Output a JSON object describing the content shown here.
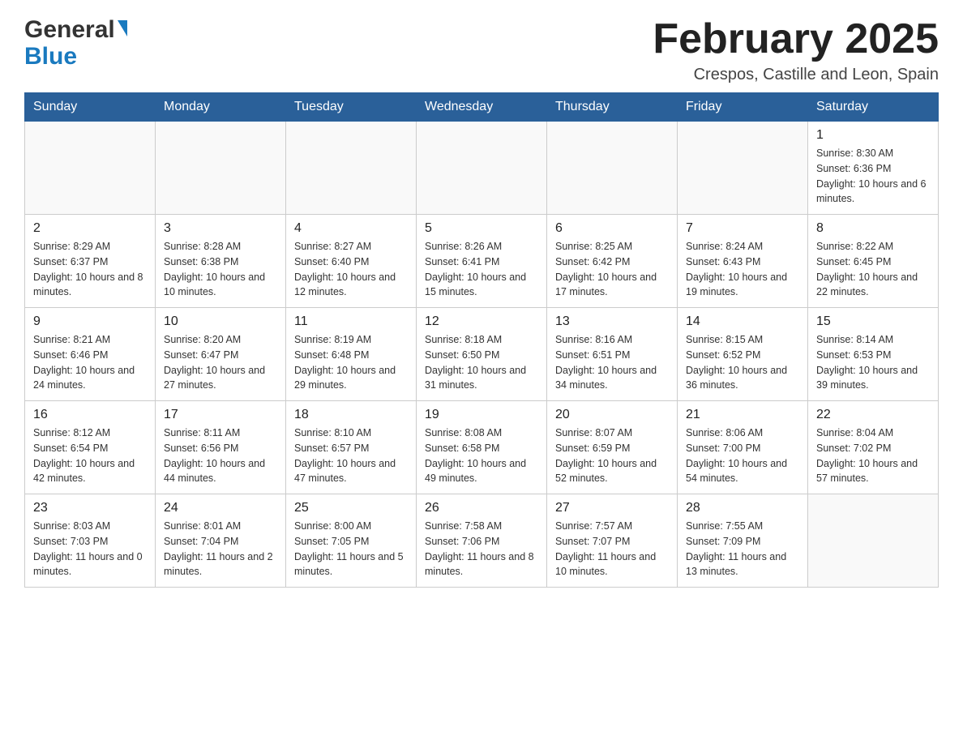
{
  "header": {
    "logo_general": "General",
    "logo_blue": "Blue",
    "month_title": "February 2025",
    "location": "Crespos, Castille and Leon, Spain"
  },
  "days_of_week": [
    "Sunday",
    "Monday",
    "Tuesday",
    "Wednesday",
    "Thursday",
    "Friday",
    "Saturday"
  ],
  "weeks": [
    [
      {
        "day": "",
        "sunrise": "",
        "sunset": "",
        "daylight": ""
      },
      {
        "day": "",
        "sunrise": "",
        "sunset": "",
        "daylight": ""
      },
      {
        "day": "",
        "sunrise": "",
        "sunset": "",
        "daylight": ""
      },
      {
        "day": "",
        "sunrise": "",
        "sunset": "",
        "daylight": ""
      },
      {
        "day": "",
        "sunrise": "",
        "sunset": "",
        "daylight": ""
      },
      {
        "day": "",
        "sunrise": "",
        "sunset": "",
        "daylight": ""
      },
      {
        "day": "1",
        "sunrise": "Sunrise: 8:30 AM",
        "sunset": "Sunset: 6:36 PM",
        "daylight": "Daylight: 10 hours and 6 minutes."
      }
    ],
    [
      {
        "day": "2",
        "sunrise": "Sunrise: 8:29 AM",
        "sunset": "Sunset: 6:37 PM",
        "daylight": "Daylight: 10 hours and 8 minutes."
      },
      {
        "day": "3",
        "sunrise": "Sunrise: 8:28 AM",
        "sunset": "Sunset: 6:38 PM",
        "daylight": "Daylight: 10 hours and 10 minutes."
      },
      {
        "day": "4",
        "sunrise": "Sunrise: 8:27 AM",
        "sunset": "Sunset: 6:40 PM",
        "daylight": "Daylight: 10 hours and 12 minutes."
      },
      {
        "day": "5",
        "sunrise": "Sunrise: 8:26 AM",
        "sunset": "Sunset: 6:41 PM",
        "daylight": "Daylight: 10 hours and 15 minutes."
      },
      {
        "day": "6",
        "sunrise": "Sunrise: 8:25 AM",
        "sunset": "Sunset: 6:42 PM",
        "daylight": "Daylight: 10 hours and 17 minutes."
      },
      {
        "day": "7",
        "sunrise": "Sunrise: 8:24 AM",
        "sunset": "Sunset: 6:43 PM",
        "daylight": "Daylight: 10 hours and 19 minutes."
      },
      {
        "day": "8",
        "sunrise": "Sunrise: 8:22 AM",
        "sunset": "Sunset: 6:45 PM",
        "daylight": "Daylight: 10 hours and 22 minutes."
      }
    ],
    [
      {
        "day": "9",
        "sunrise": "Sunrise: 8:21 AM",
        "sunset": "Sunset: 6:46 PM",
        "daylight": "Daylight: 10 hours and 24 minutes."
      },
      {
        "day": "10",
        "sunrise": "Sunrise: 8:20 AM",
        "sunset": "Sunset: 6:47 PM",
        "daylight": "Daylight: 10 hours and 27 minutes."
      },
      {
        "day": "11",
        "sunrise": "Sunrise: 8:19 AM",
        "sunset": "Sunset: 6:48 PM",
        "daylight": "Daylight: 10 hours and 29 minutes."
      },
      {
        "day": "12",
        "sunrise": "Sunrise: 8:18 AM",
        "sunset": "Sunset: 6:50 PM",
        "daylight": "Daylight: 10 hours and 31 minutes."
      },
      {
        "day": "13",
        "sunrise": "Sunrise: 8:16 AM",
        "sunset": "Sunset: 6:51 PM",
        "daylight": "Daylight: 10 hours and 34 minutes."
      },
      {
        "day": "14",
        "sunrise": "Sunrise: 8:15 AM",
        "sunset": "Sunset: 6:52 PM",
        "daylight": "Daylight: 10 hours and 36 minutes."
      },
      {
        "day": "15",
        "sunrise": "Sunrise: 8:14 AM",
        "sunset": "Sunset: 6:53 PM",
        "daylight": "Daylight: 10 hours and 39 minutes."
      }
    ],
    [
      {
        "day": "16",
        "sunrise": "Sunrise: 8:12 AM",
        "sunset": "Sunset: 6:54 PM",
        "daylight": "Daylight: 10 hours and 42 minutes."
      },
      {
        "day": "17",
        "sunrise": "Sunrise: 8:11 AM",
        "sunset": "Sunset: 6:56 PM",
        "daylight": "Daylight: 10 hours and 44 minutes."
      },
      {
        "day": "18",
        "sunrise": "Sunrise: 8:10 AM",
        "sunset": "Sunset: 6:57 PM",
        "daylight": "Daylight: 10 hours and 47 minutes."
      },
      {
        "day": "19",
        "sunrise": "Sunrise: 8:08 AM",
        "sunset": "Sunset: 6:58 PM",
        "daylight": "Daylight: 10 hours and 49 minutes."
      },
      {
        "day": "20",
        "sunrise": "Sunrise: 8:07 AM",
        "sunset": "Sunset: 6:59 PM",
        "daylight": "Daylight: 10 hours and 52 minutes."
      },
      {
        "day": "21",
        "sunrise": "Sunrise: 8:06 AM",
        "sunset": "Sunset: 7:00 PM",
        "daylight": "Daylight: 10 hours and 54 minutes."
      },
      {
        "day": "22",
        "sunrise": "Sunrise: 8:04 AM",
        "sunset": "Sunset: 7:02 PM",
        "daylight": "Daylight: 10 hours and 57 minutes."
      }
    ],
    [
      {
        "day": "23",
        "sunrise": "Sunrise: 8:03 AM",
        "sunset": "Sunset: 7:03 PM",
        "daylight": "Daylight: 11 hours and 0 minutes."
      },
      {
        "day": "24",
        "sunrise": "Sunrise: 8:01 AM",
        "sunset": "Sunset: 7:04 PM",
        "daylight": "Daylight: 11 hours and 2 minutes."
      },
      {
        "day": "25",
        "sunrise": "Sunrise: 8:00 AM",
        "sunset": "Sunset: 7:05 PM",
        "daylight": "Daylight: 11 hours and 5 minutes."
      },
      {
        "day": "26",
        "sunrise": "Sunrise: 7:58 AM",
        "sunset": "Sunset: 7:06 PM",
        "daylight": "Daylight: 11 hours and 8 minutes."
      },
      {
        "day": "27",
        "sunrise": "Sunrise: 7:57 AM",
        "sunset": "Sunset: 7:07 PM",
        "daylight": "Daylight: 11 hours and 10 minutes."
      },
      {
        "day": "28",
        "sunrise": "Sunrise: 7:55 AM",
        "sunset": "Sunset: 7:09 PM",
        "daylight": "Daylight: 11 hours and 13 minutes."
      },
      {
        "day": "",
        "sunrise": "",
        "sunset": "",
        "daylight": ""
      }
    ]
  ]
}
